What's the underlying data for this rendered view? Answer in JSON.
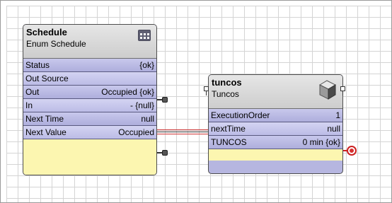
{
  "schedule_block": {
    "title": "Schedule",
    "subtitle": "Enum Schedule",
    "icon": "calendar-grid-icon",
    "rows": [
      {
        "label": "Status",
        "value": "{ok}"
      },
      {
        "label": "Out Source",
        "value": ""
      },
      {
        "label": "Out",
        "value": "Occupied {ok}"
      },
      {
        "label": "In",
        "value": "- {null}"
      },
      {
        "label": "Next Time",
        "value": "null"
      },
      {
        "label": "Next Value",
        "value": "Occupied"
      }
    ]
  },
  "tuncos_block": {
    "title": "tuncos",
    "subtitle": "Tuncos",
    "icon": "cube-icon",
    "rows": [
      {
        "label": "ExecutionOrder",
        "value": "1"
      },
      {
        "label": "nextTime",
        "value": "null"
      },
      {
        "label": "TUNCOS",
        "value": "0 min {ok}"
      }
    ]
  },
  "link": {
    "from": "Next Time",
    "to": "nextTime",
    "colors": [
      "#cc3333",
      "#333333",
      "#cc3333"
    ]
  },
  "colors": {
    "block_header": "#d6d6d6",
    "slot_row": "#b6b6e0",
    "footer": "#fcf6b0",
    "error_port": "#cc2020"
  }
}
